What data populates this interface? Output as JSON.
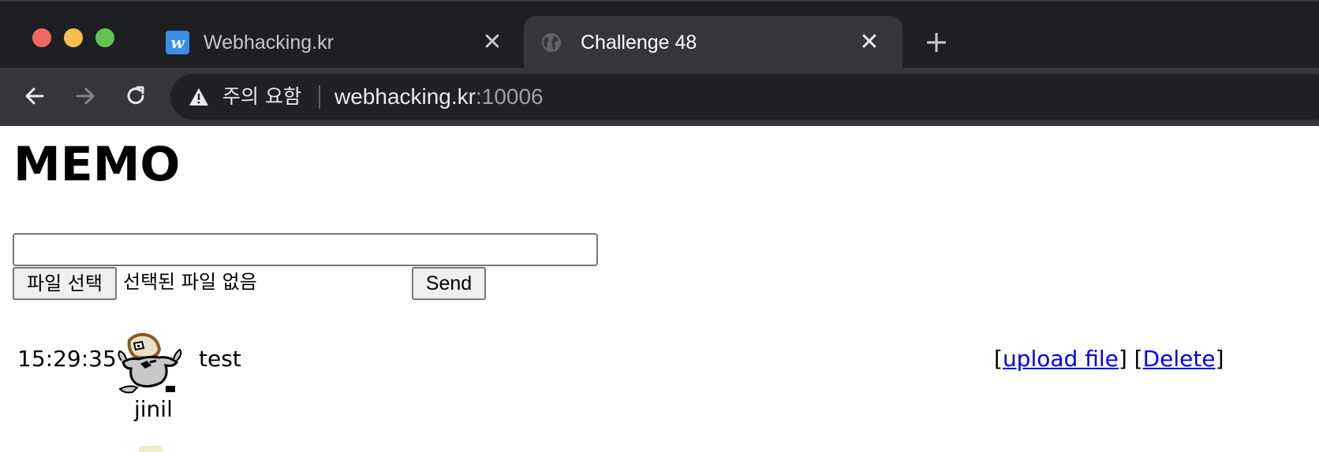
{
  "browser": {
    "tabs": [
      {
        "title": "Webhacking.kr",
        "favicon": "w-icon",
        "active": false
      },
      {
        "title": "Challenge 48",
        "favicon": "globe-icon",
        "active": true
      }
    ],
    "favicon_letter": "w",
    "close_glyph": "✕",
    "new_tab_glyph": "+",
    "security_warning": "주의 요함",
    "url_host": "webhacking.kr",
    "url_port": ":10006"
  },
  "page": {
    "title": "MEMO",
    "memo_input_value": "",
    "file_button_label": "파일 선택",
    "file_status": "선택된 파일 없음",
    "send_label": "Send"
  },
  "entries": [
    {
      "time": "15:29:35",
      "user": "jinil",
      "text": "test",
      "bracket_open": "[",
      "bracket_mid": "] [",
      "bracket_close": "]",
      "upload_link": "upload file",
      "delete_link": "Delete"
    }
  ],
  "colors": {
    "tabstrip_bg": "#1e1f22",
    "toolbar_bg": "#35363a",
    "omnibox_bg": "#202124",
    "link": "#0000ee"
  }
}
